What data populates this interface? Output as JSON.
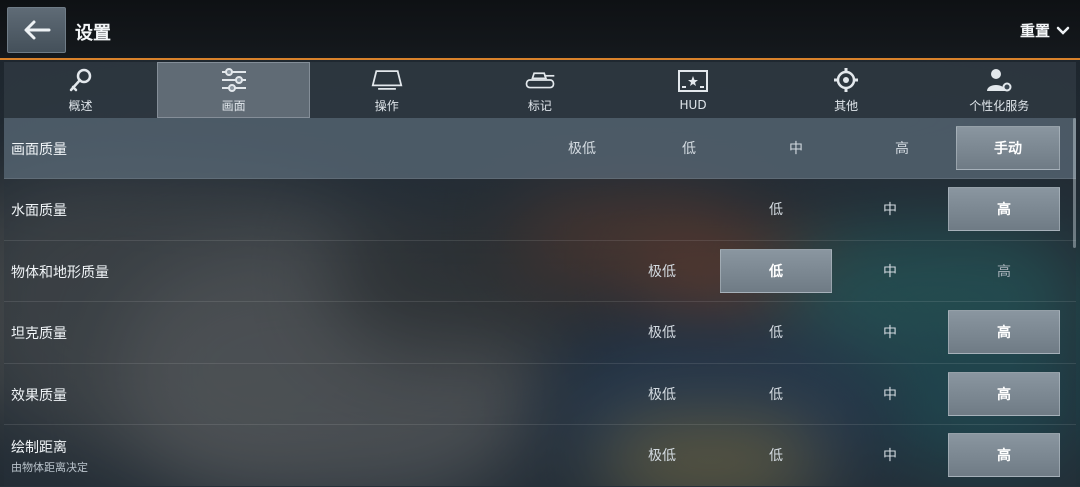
{
  "header": {
    "title": "设置",
    "reset_label": "重置"
  },
  "tabs": [
    {
      "label": "概述",
      "icon": "key-icon"
    },
    {
      "label": "画面",
      "icon": "sliders-icon",
      "active": true
    },
    {
      "label": "操作",
      "icon": "controls-icon"
    },
    {
      "label": "标记",
      "icon": "tank-icon"
    },
    {
      "label": "HUD",
      "icon": "hud-icon"
    },
    {
      "label": "其他",
      "icon": "gear-icon"
    },
    {
      "label": "个性化服务",
      "icon": "user-gear-icon"
    }
  ],
  "rows": [
    {
      "name": "画面质量",
      "options": [
        "极低",
        "低",
        "中",
        "高",
        "手动"
      ],
      "selected": "手动"
    },
    {
      "name": "水面质量",
      "options": [
        "低",
        "中",
        "高"
      ],
      "selected": "高"
    },
    {
      "name": "物体和地形质量",
      "options": [
        "极低",
        "低",
        "中",
        "高"
      ],
      "selected": "低"
    },
    {
      "name": "坦克质量",
      "options": [
        "极低",
        "低",
        "中",
        "高"
      ],
      "selected": "高"
    },
    {
      "name": "效果质量",
      "options": [
        "极低",
        "低",
        "中",
        "高"
      ],
      "selected": "高"
    },
    {
      "name": "绘制距离",
      "subtitle": "由物体距离决定",
      "options": [
        "极低",
        "低",
        "中",
        "高"
      ],
      "selected": "高"
    }
  ],
  "colors": {
    "accent": "#d9822b",
    "selected_bg": "#7c8892"
  }
}
